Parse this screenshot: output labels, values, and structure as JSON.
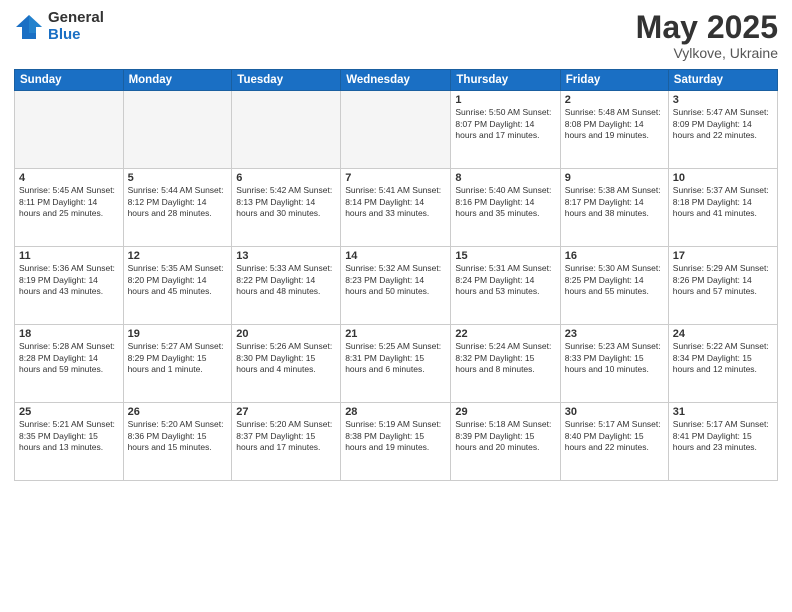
{
  "header": {
    "logo_general": "General",
    "logo_blue": "Blue",
    "title": "May 2025",
    "location": "Vylkove, Ukraine"
  },
  "weekdays": [
    "Sunday",
    "Monday",
    "Tuesday",
    "Wednesday",
    "Thursday",
    "Friday",
    "Saturday"
  ],
  "weeks": [
    [
      {
        "day": "",
        "info": ""
      },
      {
        "day": "",
        "info": ""
      },
      {
        "day": "",
        "info": ""
      },
      {
        "day": "",
        "info": ""
      },
      {
        "day": "1",
        "info": "Sunrise: 5:50 AM\nSunset: 8:07 PM\nDaylight: 14 hours\nand 17 minutes."
      },
      {
        "day": "2",
        "info": "Sunrise: 5:48 AM\nSunset: 8:08 PM\nDaylight: 14 hours\nand 19 minutes."
      },
      {
        "day": "3",
        "info": "Sunrise: 5:47 AM\nSunset: 8:09 PM\nDaylight: 14 hours\nand 22 minutes."
      }
    ],
    [
      {
        "day": "4",
        "info": "Sunrise: 5:45 AM\nSunset: 8:11 PM\nDaylight: 14 hours\nand 25 minutes."
      },
      {
        "day": "5",
        "info": "Sunrise: 5:44 AM\nSunset: 8:12 PM\nDaylight: 14 hours\nand 28 minutes."
      },
      {
        "day": "6",
        "info": "Sunrise: 5:42 AM\nSunset: 8:13 PM\nDaylight: 14 hours\nand 30 minutes."
      },
      {
        "day": "7",
        "info": "Sunrise: 5:41 AM\nSunset: 8:14 PM\nDaylight: 14 hours\nand 33 minutes."
      },
      {
        "day": "8",
        "info": "Sunrise: 5:40 AM\nSunset: 8:16 PM\nDaylight: 14 hours\nand 35 minutes."
      },
      {
        "day": "9",
        "info": "Sunrise: 5:38 AM\nSunset: 8:17 PM\nDaylight: 14 hours\nand 38 minutes."
      },
      {
        "day": "10",
        "info": "Sunrise: 5:37 AM\nSunset: 8:18 PM\nDaylight: 14 hours\nand 41 minutes."
      }
    ],
    [
      {
        "day": "11",
        "info": "Sunrise: 5:36 AM\nSunset: 8:19 PM\nDaylight: 14 hours\nand 43 minutes."
      },
      {
        "day": "12",
        "info": "Sunrise: 5:35 AM\nSunset: 8:20 PM\nDaylight: 14 hours\nand 45 minutes."
      },
      {
        "day": "13",
        "info": "Sunrise: 5:33 AM\nSunset: 8:22 PM\nDaylight: 14 hours\nand 48 minutes."
      },
      {
        "day": "14",
        "info": "Sunrise: 5:32 AM\nSunset: 8:23 PM\nDaylight: 14 hours\nand 50 minutes."
      },
      {
        "day": "15",
        "info": "Sunrise: 5:31 AM\nSunset: 8:24 PM\nDaylight: 14 hours\nand 53 minutes."
      },
      {
        "day": "16",
        "info": "Sunrise: 5:30 AM\nSunset: 8:25 PM\nDaylight: 14 hours\nand 55 minutes."
      },
      {
        "day": "17",
        "info": "Sunrise: 5:29 AM\nSunset: 8:26 PM\nDaylight: 14 hours\nand 57 minutes."
      }
    ],
    [
      {
        "day": "18",
        "info": "Sunrise: 5:28 AM\nSunset: 8:28 PM\nDaylight: 14 hours\nand 59 minutes."
      },
      {
        "day": "19",
        "info": "Sunrise: 5:27 AM\nSunset: 8:29 PM\nDaylight: 15 hours\nand 1 minute."
      },
      {
        "day": "20",
        "info": "Sunrise: 5:26 AM\nSunset: 8:30 PM\nDaylight: 15 hours\nand 4 minutes."
      },
      {
        "day": "21",
        "info": "Sunrise: 5:25 AM\nSunset: 8:31 PM\nDaylight: 15 hours\nand 6 minutes."
      },
      {
        "day": "22",
        "info": "Sunrise: 5:24 AM\nSunset: 8:32 PM\nDaylight: 15 hours\nand 8 minutes."
      },
      {
        "day": "23",
        "info": "Sunrise: 5:23 AM\nSunset: 8:33 PM\nDaylight: 15 hours\nand 10 minutes."
      },
      {
        "day": "24",
        "info": "Sunrise: 5:22 AM\nSunset: 8:34 PM\nDaylight: 15 hours\nand 12 minutes."
      }
    ],
    [
      {
        "day": "25",
        "info": "Sunrise: 5:21 AM\nSunset: 8:35 PM\nDaylight: 15 hours\nand 13 minutes."
      },
      {
        "day": "26",
        "info": "Sunrise: 5:20 AM\nSunset: 8:36 PM\nDaylight: 15 hours\nand 15 minutes."
      },
      {
        "day": "27",
        "info": "Sunrise: 5:20 AM\nSunset: 8:37 PM\nDaylight: 15 hours\nand 17 minutes."
      },
      {
        "day": "28",
        "info": "Sunrise: 5:19 AM\nSunset: 8:38 PM\nDaylight: 15 hours\nand 19 minutes."
      },
      {
        "day": "29",
        "info": "Sunrise: 5:18 AM\nSunset: 8:39 PM\nDaylight: 15 hours\nand 20 minutes."
      },
      {
        "day": "30",
        "info": "Sunrise: 5:17 AM\nSunset: 8:40 PM\nDaylight: 15 hours\nand 22 minutes."
      },
      {
        "day": "31",
        "info": "Sunrise: 5:17 AM\nSunset: 8:41 PM\nDaylight: 15 hours\nand 23 minutes."
      }
    ]
  ]
}
